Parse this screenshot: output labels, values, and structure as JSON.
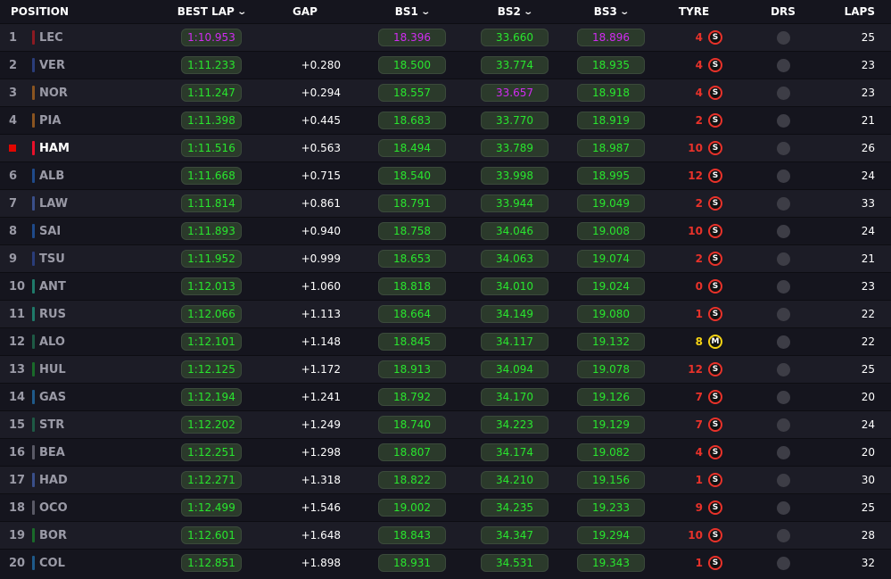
{
  "header": {
    "position": "POSITION",
    "best_lap": "BEST LAP",
    "gap": "GAP",
    "bs1": "BS1",
    "bs2": "BS2",
    "bs3": "BS3",
    "tyre": "TYRE",
    "drs": "DRS",
    "laps": "LAPS"
  },
  "colors": {
    "green_sector": "#29e62e",
    "purple_sector": "#d02cf0",
    "soft_tyre": "#e8322a",
    "medium_tyre": "#f5d314",
    "favourite_marker": "#e10600"
  },
  "rows": [
    {
      "pos": "1",
      "code": "LEC",
      "team_color": "#8b1a22",
      "best": "1:10.953",
      "best_c": "purple",
      "gap": "",
      "bs1": "18.396",
      "bs1_c": "purple",
      "bs2": "33.660",
      "bs2_c": "green",
      "bs3": "18.896",
      "bs3_c": "purple",
      "tyre_age": "4",
      "tyre": "S",
      "laps": "25"
    },
    {
      "pos": "2",
      "code": "VER",
      "team_color": "#2a3d7a",
      "best": "1:11.233",
      "best_c": "green",
      "gap": "+0.280",
      "bs1": "18.500",
      "bs1_c": "green",
      "bs2": "33.774",
      "bs2_c": "green",
      "bs3": "18.935",
      "bs3_c": "green",
      "tyre_age": "4",
      "tyre": "S",
      "laps": "23"
    },
    {
      "pos": "3",
      "code": "NOR",
      "team_color": "#8a5420",
      "best": "1:11.247",
      "best_c": "green",
      "gap": "+0.294",
      "bs1": "18.557",
      "bs1_c": "green",
      "bs2": "33.657",
      "bs2_c": "purple",
      "bs3": "18.918",
      "bs3_c": "green",
      "tyre_age": "4",
      "tyre": "S",
      "laps": "23"
    },
    {
      "pos": "4",
      "code": "PIA",
      "team_color": "#8a5420",
      "best": "1:11.398",
      "best_c": "green",
      "gap": "+0.445",
      "bs1": "18.683",
      "bs1_c": "green",
      "bs2": "33.770",
      "bs2_c": "green",
      "bs3": "18.919",
      "bs3_c": "green",
      "tyre_age": "2",
      "tyre": "S",
      "laps": "21"
    },
    {
      "pos": "5",
      "code": "HAM",
      "team_color": "#e8102a",
      "best": "1:11.516",
      "best_c": "green",
      "gap": "+0.563",
      "bs1": "18.494",
      "bs1_c": "green",
      "bs2": "33.789",
      "bs2_c": "green",
      "bs3": "18.987",
      "bs3_c": "green",
      "tyre_age": "10",
      "tyre": "S",
      "laps": "26",
      "favourite": true
    },
    {
      "pos": "6",
      "code": "ALB",
      "team_color": "#1f4a8a",
      "best": "1:11.668",
      "best_c": "green",
      "gap": "+0.715",
      "bs1": "18.540",
      "bs1_c": "green",
      "bs2": "33.998",
      "bs2_c": "green",
      "bs3": "18.995",
      "bs3_c": "green",
      "tyre_age": "12",
      "tyre": "S",
      "laps": "24"
    },
    {
      "pos": "7",
      "code": "LAW",
      "team_color": "#3a4f8a",
      "best": "1:11.814",
      "best_c": "green",
      "gap": "+0.861",
      "bs1": "18.791",
      "bs1_c": "green",
      "bs2": "33.944",
      "bs2_c": "green",
      "bs3": "19.049",
      "bs3_c": "green",
      "tyre_age": "2",
      "tyre": "S",
      "laps": "33"
    },
    {
      "pos": "8",
      "code": "SAI",
      "team_color": "#1f4a8a",
      "best": "1:11.893",
      "best_c": "green",
      "gap": "+0.940",
      "bs1": "18.758",
      "bs1_c": "green",
      "bs2": "34.046",
      "bs2_c": "green",
      "bs3": "19.008",
      "bs3_c": "green",
      "tyre_age": "10",
      "tyre": "S",
      "laps": "24"
    },
    {
      "pos": "9",
      "code": "TSU",
      "team_color": "#2a3d7a",
      "best": "1:11.952",
      "best_c": "green",
      "gap": "+0.999",
      "bs1": "18.653",
      "bs1_c": "green",
      "bs2": "34.063",
      "bs2_c": "green",
      "bs3": "19.074",
      "bs3_c": "green",
      "tyre_age": "2",
      "tyre": "S",
      "laps": "21"
    },
    {
      "pos": "10",
      "code": "ANT",
      "team_color": "#1f7a6a",
      "best": "1:12.013",
      "best_c": "green",
      "gap": "+1.060",
      "bs1": "18.818",
      "bs1_c": "green",
      "bs2": "34.010",
      "bs2_c": "green",
      "bs3": "19.024",
      "bs3_c": "green",
      "tyre_age": "0",
      "tyre": "S",
      "laps": "23"
    },
    {
      "pos": "11",
      "code": "RUS",
      "team_color": "#1f7a6a",
      "best": "1:12.066",
      "best_c": "green",
      "gap": "+1.113",
      "bs1": "18.664",
      "bs1_c": "green",
      "bs2": "34.149",
      "bs2_c": "green",
      "bs3": "19.080",
      "bs3_c": "green",
      "tyre_age": "1",
      "tyre": "S",
      "laps": "22"
    },
    {
      "pos": "12",
      "code": "ALO",
      "team_color": "#1e5a45",
      "best": "1:12.101",
      "best_c": "green",
      "gap": "+1.148",
      "bs1": "18.845",
      "bs1_c": "green",
      "bs2": "34.117",
      "bs2_c": "green",
      "bs3": "19.132",
      "bs3_c": "green",
      "tyre_age": "8",
      "tyre": "M",
      "laps": "22"
    },
    {
      "pos": "13",
      "code": "HUL",
      "team_color": "#1a6a2a",
      "best": "1:12.125",
      "best_c": "green",
      "gap": "+1.172",
      "bs1": "18.913",
      "bs1_c": "green",
      "bs2": "34.094",
      "bs2_c": "green",
      "bs3": "19.078",
      "bs3_c": "green",
      "tyre_age": "12",
      "tyre": "S",
      "laps": "25"
    },
    {
      "pos": "14",
      "code": "GAS",
      "team_color": "#1f5a8a",
      "best": "1:12.194",
      "best_c": "green",
      "gap": "+1.241",
      "bs1": "18.792",
      "bs1_c": "green",
      "bs2": "34.170",
      "bs2_c": "green",
      "bs3": "19.126",
      "bs3_c": "green",
      "tyre_age": "7",
      "tyre": "S",
      "laps": "20"
    },
    {
      "pos": "15",
      "code": "STR",
      "team_color": "#1e5a45",
      "best": "1:12.202",
      "best_c": "green",
      "gap": "+1.249",
      "bs1": "18.740",
      "bs1_c": "green",
      "bs2": "34.223",
      "bs2_c": "green",
      "bs3": "19.129",
      "bs3_c": "green",
      "tyre_age": "7",
      "tyre": "S",
      "laps": "24"
    },
    {
      "pos": "16",
      "code": "BEA",
      "team_color": "#5a5a66",
      "best": "1:12.251",
      "best_c": "green",
      "gap": "+1.298",
      "bs1": "18.807",
      "bs1_c": "green",
      "bs2": "34.174",
      "bs2_c": "green",
      "bs3": "19.082",
      "bs3_c": "green",
      "tyre_age": "4",
      "tyre": "S",
      "laps": "20"
    },
    {
      "pos": "17",
      "code": "HAD",
      "team_color": "#3a4f8a",
      "best": "1:12.271",
      "best_c": "green",
      "gap": "+1.318",
      "bs1": "18.822",
      "bs1_c": "green",
      "bs2": "34.210",
      "bs2_c": "green",
      "bs3": "19.156",
      "bs3_c": "green",
      "tyre_age": "1",
      "tyre": "S",
      "laps": "30"
    },
    {
      "pos": "18",
      "code": "OCO",
      "team_color": "#5a5a66",
      "best": "1:12.499",
      "best_c": "green",
      "gap": "+1.546",
      "bs1": "19.002",
      "bs1_c": "green",
      "bs2": "34.235",
      "bs2_c": "green",
      "bs3": "19.233",
      "bs3_c": "green",
      "tyre_age": "9",
      "tyre": "S",
      "laps": "25"
    },
    {
      "pos": "19",
      "code": "BOR",
      "team_color": "#1a6a2a",
      "best": "1:12.601",
      "best_c": "green",
      "gap": "+1.648",
      "bs1": "18.843",
      "bs1_c": "green",
      "bs2": "34.347",
      "bs2_c": "green",
      "bs3": "19.294",
      "bs3_c": "green",
      "tyre_age": "10",
      "tyre": "S",
      "laps": "28"
    },
    {
      "pos": "20",
      "code": "COL",
      "team_color": "#1f5a8a",
      "best": "1:12.851",
      "best_c": "green",
      "gap": "+1.898",
      "bs1": "18.931",
      "bs1_c": "green",
      "bs2": "34.531",
      "bs2_c": "green",
      "bs3": "19.343",
      "bs3_c": "green",
      "tyre_age": "1",
      "tyre": "S",
      "laps": "32"
    }
  ]
}
